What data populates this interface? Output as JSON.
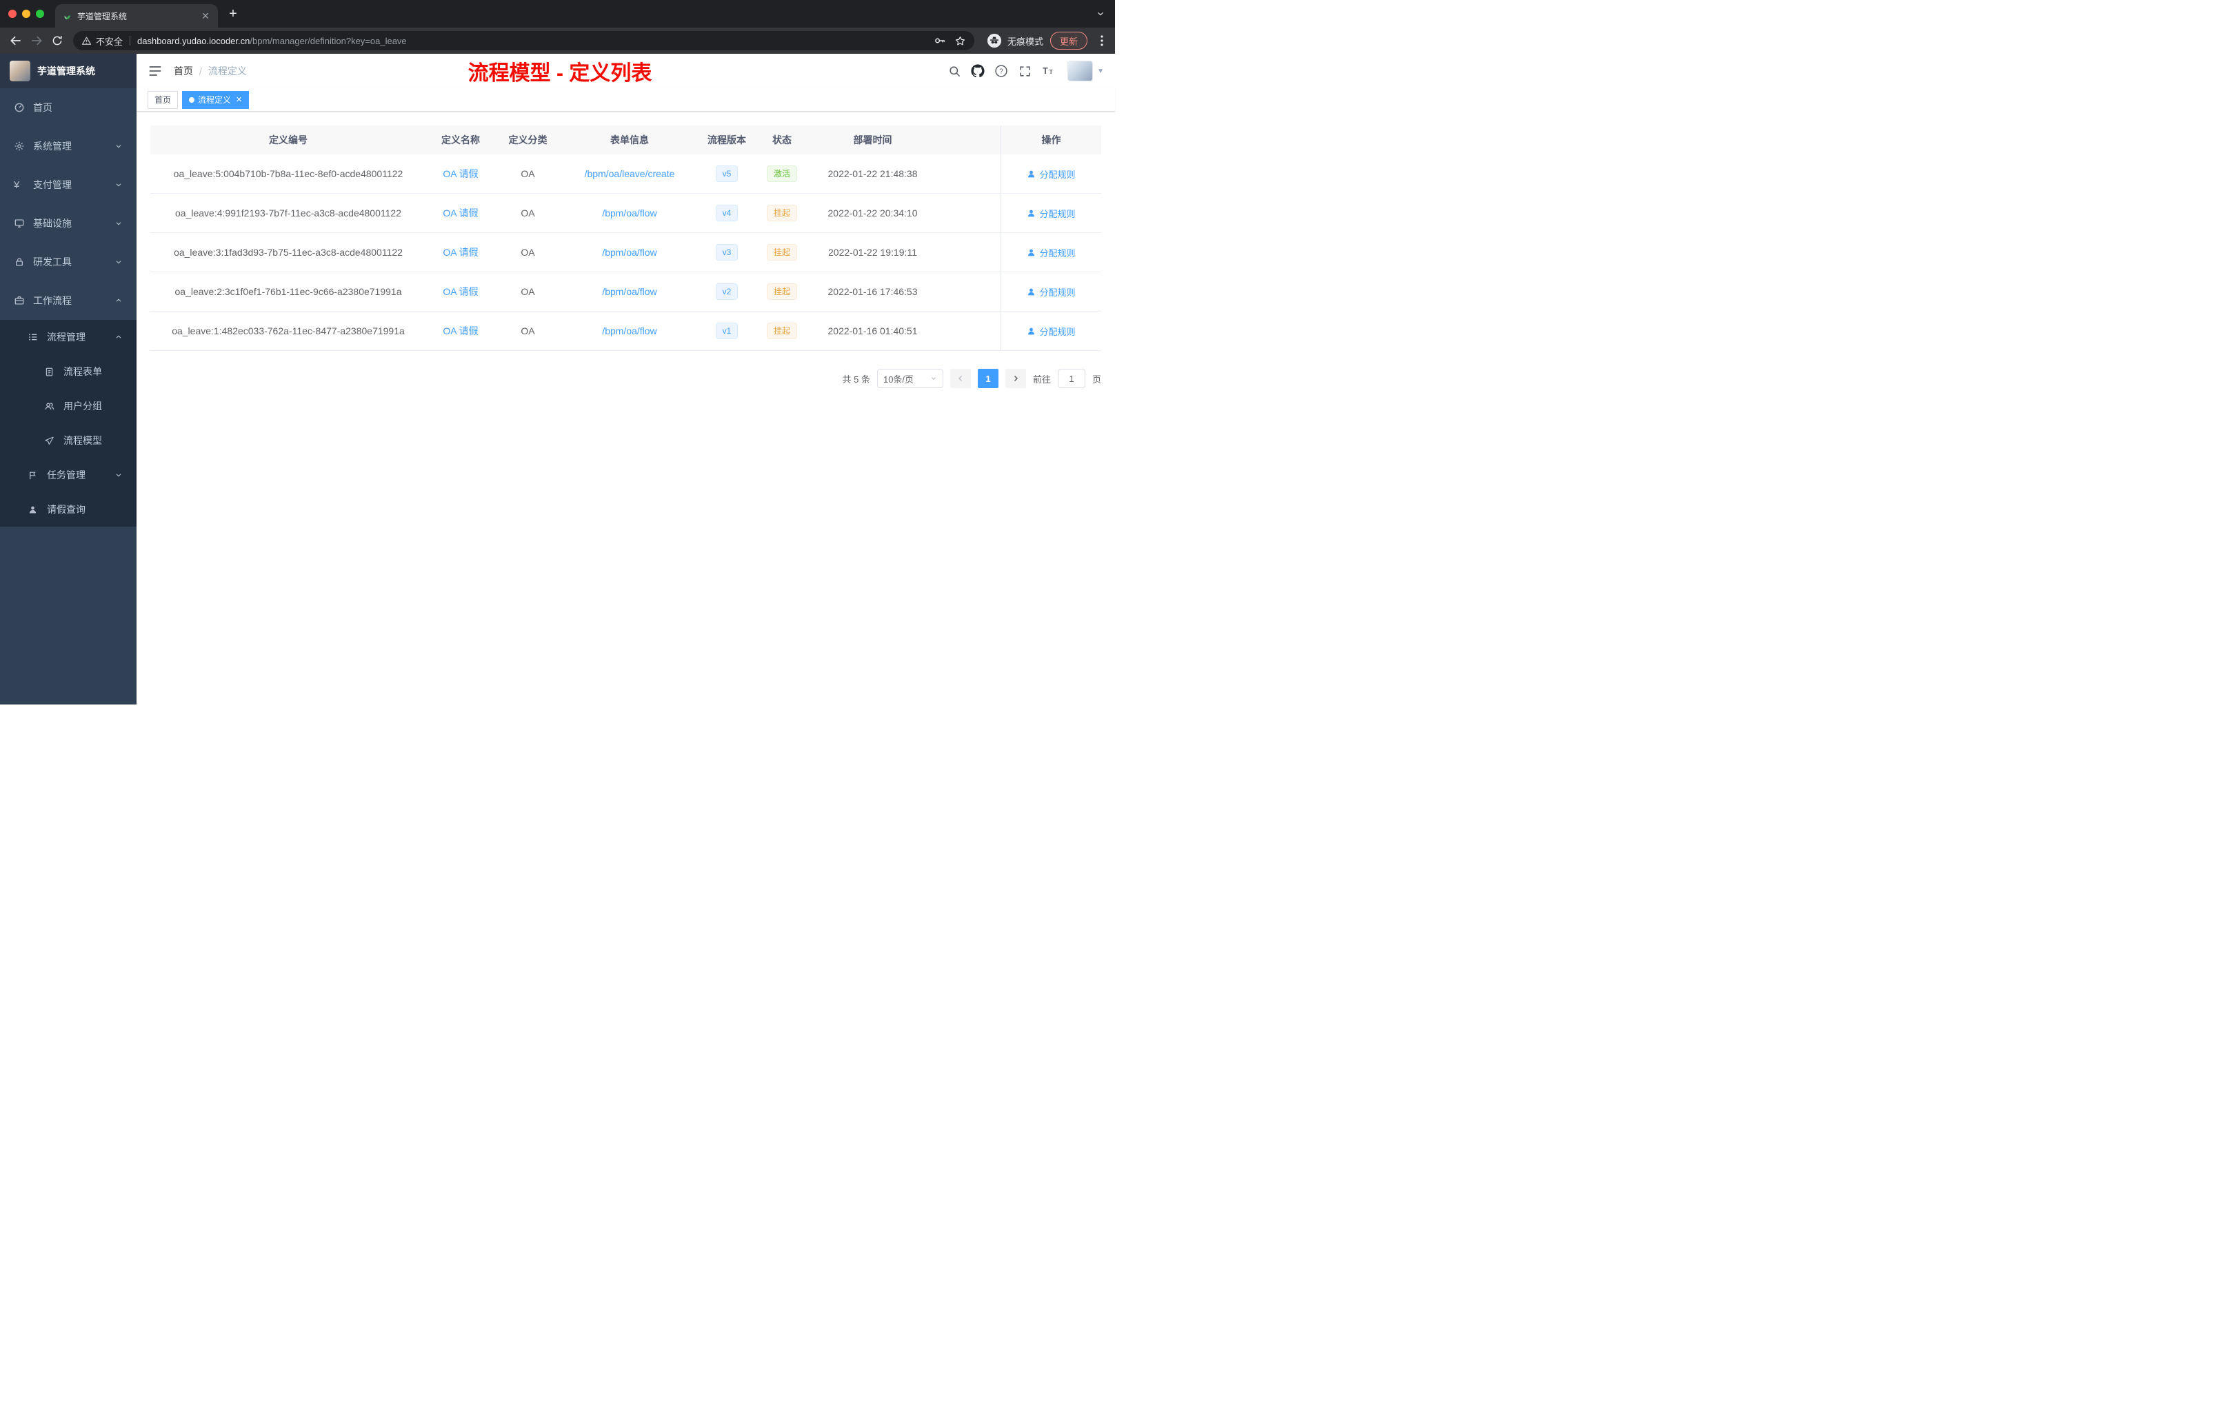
{
  "browser": {
    "tab_title": "芋道管理系统",
    "security_label": "不安全",
    "url_host": "dashboard.yudao.iocoder.cn",
    "url_path": "/bpm/manager/definition?key=oa_leave",
    "incognito_label": "无痕模式",
    "update_label": "更新"
  },
  "sidebar": {
    "app_title": "芋道管理系统",
    "menu": {
      "home": "首页",
      "system": "系统管理",
      "payment": "支付管理",
      "infra": "基础设施",
      "devtools": "研发工具",
      "workflow": "工作流程",
      "process_mgmt": "流程管理",
      "process_form": "流程表单",
      "user_group": "用户分组",
      "process_model": "流程模型",
      "task_mgmt": "任务管理",
      "leave_query": "请假查询"
    }
  },
  "header": {
    "breadcrumb_home": "首页",
    "breadcrumb_current": "流程定义",
    "annotation": "流程模型 - 定义列表"
  },
  "tags": {
    "home": "首页",
    "current": "流程定义"
  },
  "table": {
    "columns": [
      "定义编号",
      "定义名称",
      "定义分类",
      "表单信息",
      "流程版本",
      "状态",
      "部署时间",
      "操作"
    ],
    "rows": [
      {
        "id": "oa_leave:5:004b710b-7b8a-11ec-8ef0-acde48001122",
        "name": "OA 请假",
        "category": "OA",
        "form": "/bpm/oa/leave/create",
        "version": "v5",
        "status": "激活",
        "status_class": "success",
        "deployed_at": "2022-01-22 21:48:38",
        "action": "分配规则"
      },
      {
        "id": "oa_leave:4:991f2193-7b7f-11ec-a3c8-acde48001122",
        "name": "OA 请假",
        "category": "OA",
        "form": "/bpm/oa/flow",
        "version": "v4",
        "status": "挂起",
        "status_class": "warning",
        "deployed_at": "2022-01-22 20:34:10",
        "action": "分配规则"
      },
      {
        "id": "oa_leave:3:1fad3d93-7b75-11ec-a3c8-acde48001122",
        "name": "OA 请假",
        "category": "OA",
        "form": "/bpm/oa/flow",
        "version": "v3",
        "status": "挂起",
        "status_class": "warning",
        "deployed_at": "2022-01-22 19:19:11",
        "action": "分配规则"
      },
      {
        "id": "oa_leave:2:3c1f0ef1-76b1-11ec-9c66-a2380e71991a",
        "name": "OA 请假",
        "category": "OA",
        "form": "/bpm/oa/flow",
        "version": "v2",
        "status": "挂起",
        "status_class": "warning",
        "deployed_at": "2022-01-16 17:46:53",
        "action": "分配规则"
      },
      {
        "id": "oa_leave:1:482ec033-762a-11ec-8477-a2380e71991a",
        "name": "OA 请假",
        "category": "OA",
        "form": "/bpm/oa/flow",
        "version": "v1",
        "status": "挂起",
        "status_class": "warning",
        "deployed_at": "2022-01-16 01:40:51",
        "action": "分配规则"
      }
    ]
  },
  "pagination": {
    "total": "共 5 条",
    "page_size": "10条/页",
    "current_page": "1",
    "goto": "前往",
    "goto_value": "1",
    "page_suffix": "页"
  },
  "colors": {
    "accent": "#409eff",
    "success": "#67c23a",
    "warning": "#e6a23c",
    "annotation_red": "#f20c00",
    "sidebar_bg": "#304156",
    "submenu_bg": "#1f2d3d"
  }
}
